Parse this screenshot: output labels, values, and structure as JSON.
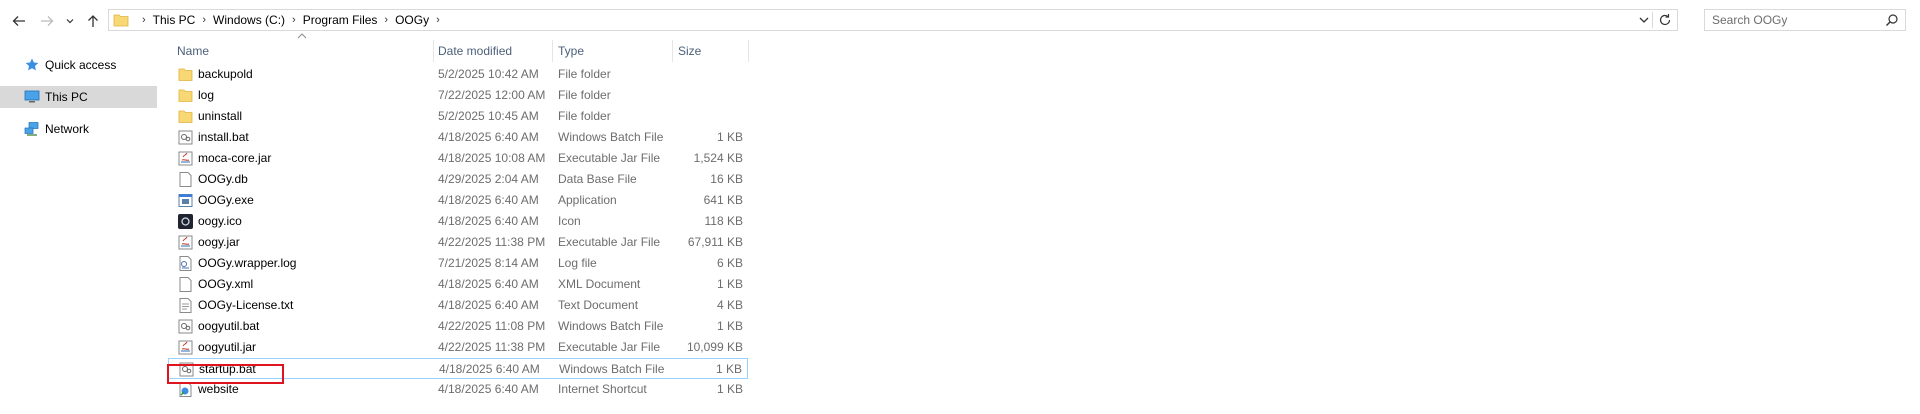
{
  "address": {
    "crumbs": [
      "This PC",
      "Windows (C:)",
      "Program Files",
      "OOGy"
    ]
  },
  "search": {
    "placeholder": "Search OOGy"
  },
  "nav": {
    "items": [
      {
        "label": "Quick access",
        "icon": "star-icon"
      },
      {
        "label": "This PC",
        "icon": "computer-icon"
      },
      {
        "label": "Network",
        "icon": "network-icon"
      }
    ]
  },
  "columns": {
    "name": "Name",
    "date": "Date modified",
    "type": "Type",
    "size": "Size"
  },
  "files": [
    {
      "name": "backupold",
      "date": "5/2/2025 10:42 AM",
      "type": "File folder",
      "size": "",
      "icon": "folder"
    },
    {
      "name": "log",
      "date": "7/22/2025 12:00 AM",
      "type": "File folder",
      "size": "",
      "icon": "folder"
    },
    {
      "name": "uninstall",
      "date": "5/2/2025 10:45 AM",
      "type": "File folder",
      "size": "",
      "icon": "folder"
    },
    {
      "name": "install.bat",
      "date": "4/18/2025 6:40 AM",
      "type": "Windows Batch File",
      "size": "1 KB",
      "icon": "batch"
    },
    {
      "name": "moca-core.jar",
      "date": "4/18/2025 10:08 AM",
      "type": "Executable Jar File",
      "size": "1,524 KB",
      "icon": "jar"
    },
    {
      "name": "OOGy.db",
      "date": "4/29/2025 2:04 AM",
      "type": "Data Base File",
      "size": "16 KB",
      "icon": "db"
    },
    {
      "name": "OOGy.exe",
      "date": "4/18/2025 6:40 AM",
      "type": "Application",
      "size": "641 KB",
      "icon": "exe"
    },
    {
      "name": "oogy.ico",
      "date": "4/18/2025 6:40 AM",
      "type": "Icon",
      "size": "118 KB",
      "icon": "ico"
    },
    {
      "name": "oogy.jar",
      "date": "4/22/2025 11:38 PM",
      "type": "Executable Jar File",
      "size": "67,911 KB",
      "icon": "jar"
    },
    {
      "name": "OOGy.wrapper.log",
      "date": "7/21/2025 8:14 AM",
      "type": "Log file",
      "size": "6 KB",
      "icon": "log"
    },
    {
      "name": "OOGy.xml",
      "date": "4/18/2025 6:40 AM",
      "type": "XML Document",
      "size": "1 KB",
      "icon": "doc"
    },
    {
      "name": "OOGy-License.txt",
      "date": "4/18/2025 6:40 AM",
      "type": "Text Document",
      "size": "4 KB",
      "icon": "txt"
    },
    {
      "name": "oogyutil.bat",
      "date": "4/22/2025 11:08 PM",
      "type": "Windows Batch File",
      "size": "1 KB",
      "icon": "batch"
    },
    {
      "name": "oogyutil.jar",
      "date": "4/22/2025 11:38 PM",
      "type": "Executable Jar File",
      "size": "10,099 KB",
      "icon": "jar"
    },
    {
      "name": "startup.bat",
      "date": "4/18/2025 6:40 AM",
      "type": "Windows Batch File",
      "size": "1 KB",
      "icon": "batch"
    },
    {
      "name": "website",
      "date": "4/18/2025 6:40 AM",
      "type": "Internet Shortcut",
      "size": "1 KB",
      "icon": "url"
    }
  ]
}
